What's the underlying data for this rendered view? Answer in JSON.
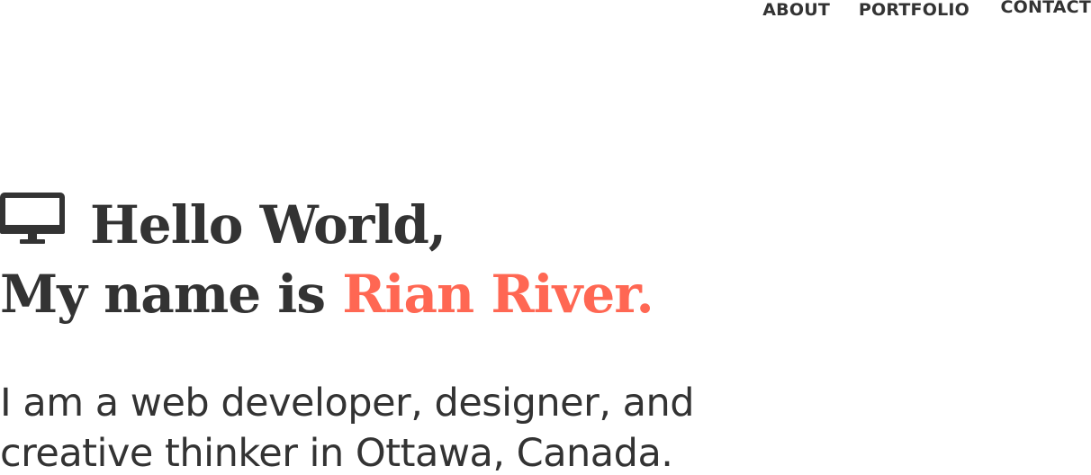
{
  "nav": {
    "items": [
      {
        "label": "ABOUT"
      },
      {
        "label": "PORTFOLIO"
      },
      {
        "label": "CONTACT"
      }
    ]
  },
  "hero": {
    "icon": "desktop-monitor-icon",
    "greeting": "Hello World,",
    "name_prefix": "My name is ",
    "name": "Rian River.",
    "accent_color": "#ff6753",
    "text_color": "#333333"
  },
  "intro": {
    "line1": "I am a web developer, designer, and",
    "line2": "creative thinker in Ottawa, Canada."
  }
}
